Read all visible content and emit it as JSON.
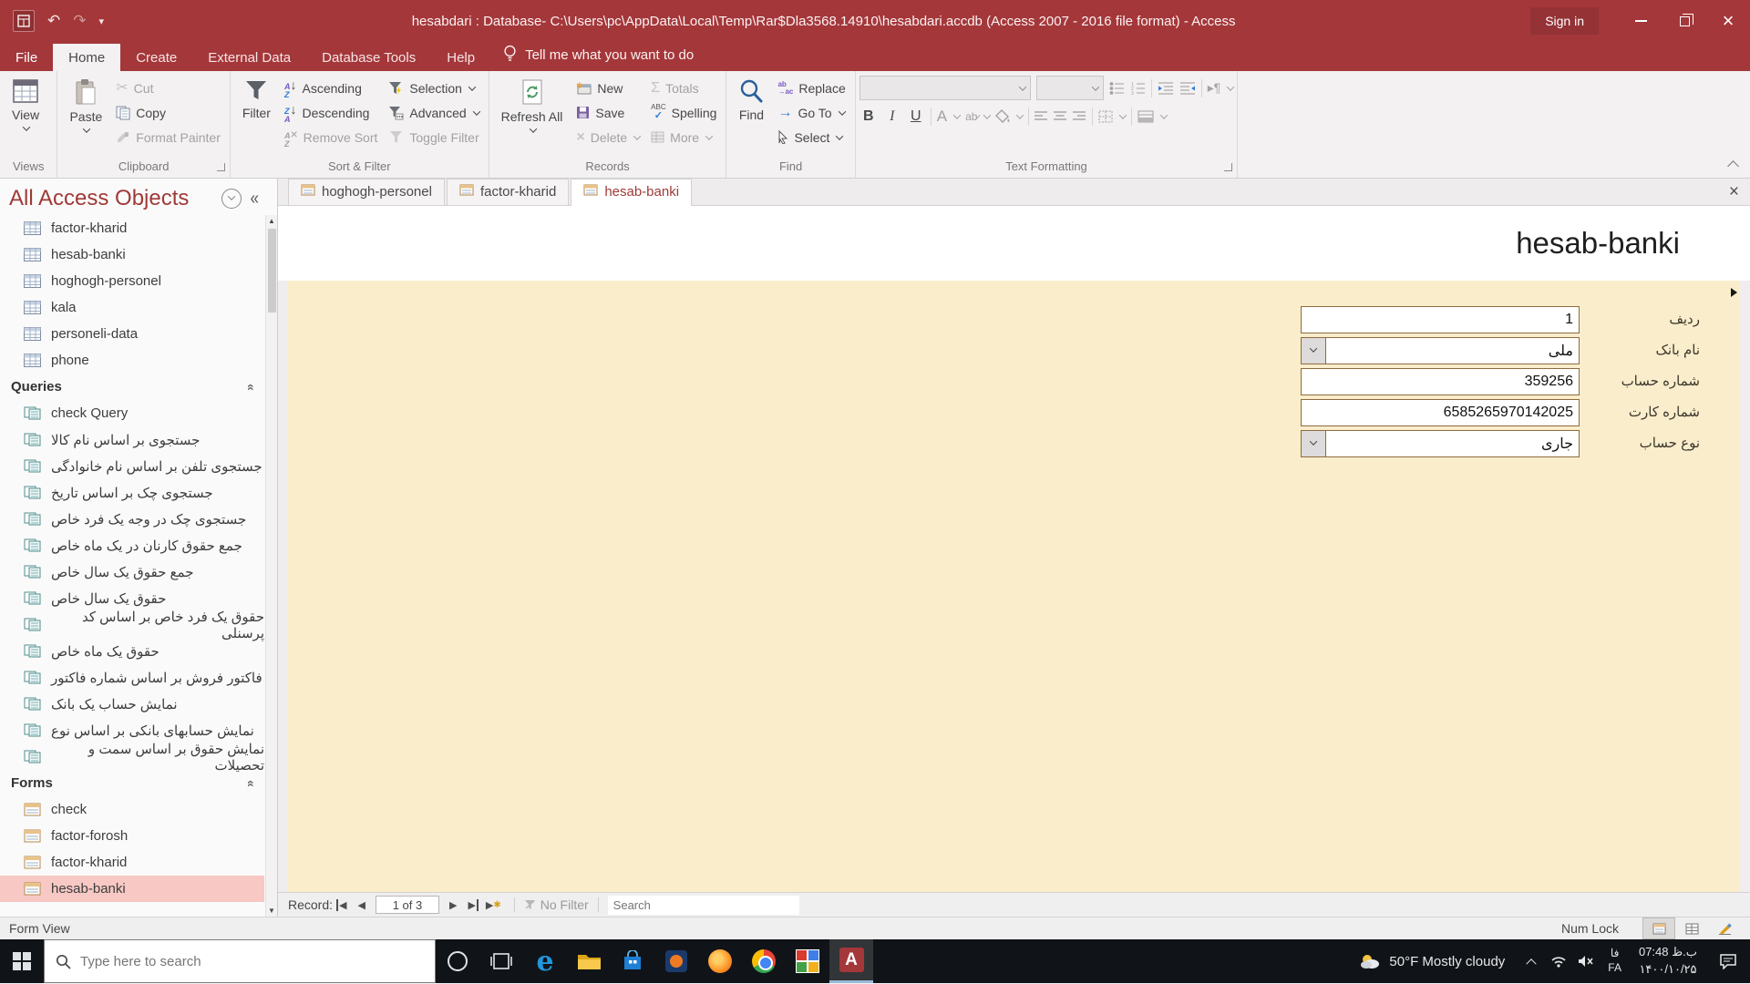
{
  "titlebar": {
    "title": "hesabdari : Database- C:\\Users\\pc\\AppData\\Local\\Temp\\Rar$Dla3568.14910\\hesabdari.accdb (Access 2007 - 2016 file format)  -  Access",
    "sign_in": "Sign in"
  },
  "menu": {
    "file": "File",
    "home": "Home",
    "create": "Create",
    "external_data": "External Data",
    "database_tools": "Database Tools",
    "help": "Help",
    "tell_me": "Tell me what you want to do"
  },
  "ribbon": {
    "views": {
      "label": "Views",
      "view": "View"
    },
    "clipboard": {
      "label": "Clipboard",
      "paste": "Paste",
      "cut": "Cut",
      "copy": "Copy",
      "format_painter": "Format Painter"
    },
    "sort_filter": {
      "label": "Sort & Filter",
      "filter": "Filter",
      "ascending": "Ascending",
      "descending": "Descending",
      "remove_sort": "Remove Sort",
      "selection": "Selection",
      "advanced": "Advanced",
      "toggle_filter": "Toggle Filter"
    },
    "records": {
      "label": "Records",
      "refresh_all": "Refresh All",
      "new": "New",
      "save": "Save",
      "delete": "Delete",
      "totals": "Totals",
      "spelling": "Spelling",
      "more": "More"
    },
    "find": {
      "label": "Find",
      "find": "Find",
      "replace": "Replace",
      "go_to": "Go To",
      "select": "Select"
    },
    "text_formatting": {
      "label": "Text Formatting"
    }
  },
  "nav": {
    "header": "All Access Objects",
    "tables": [
      "factor-kharid",
      "hesab-banki",
      "hoghogh-personel",
      "kala",
      "personeli-data",
      "phone"
    ],
    "queries_header": "Queries",
    "queries": [
      "check Query",
      "جستجوی بر اساس نام کالا",
      "جستجوی تلفن بر اساس نام خانوادگی",
      "جستجوی چک بر اساس تاریخ",
      "جستجوی چک در وجه یک فرد خاص",
      "جمع حقوق کارنان در یک ماه خاص",
      "جمع حقوق یک سال خاص",
      "حقوق یک سال خاص",
      "حقوق یک فرد خاص بر اساس کد پرسنلی",
      "حقوق یک ماه خاص",
      "فاکتور فروش بر اساس شماره فاکتور",
      "نمایش حساب یک بانک",
      "نمایش حسابهای بانکی بر اساس نوع",
      "نمایش حقوق بر اساس سمت و تحصیلات"
    ],
    "forms_header": "Forms",
    "forms": [
      "check",
      "factor-forosh",
      "factor-kharid",
      "hesab-banki"
    ],
    "selected_form": "hesab-banki"
  },
  "doc_tabs": [
    "hoghogh-personel",
    "factor-kharid",
    "hesab-banki"
  ],
  "form": {
    "title": "hesab-banki",
    "fields": [
      {
        "label": "ردیف",
        "value": "1"
      },
      {
        "label": "نام بانک",
        "value": "ملی"
      },
      {
        "label": "شماره حساب",
        "value": "359256"
      },
      {
        "label": "شماره کارت",
        "value": "6585265970142025"
      },
      {
        "label": "نوع حساب",
        "value": "جاری"
      }
    ]
  },
  "record_nav": {
    "record_label": "Record:",
    "position": "1 of 3",
    "no_filter": "No Filter",
    "search_placeholder": "Search"
  },
  "statusbar": {
    "left": "Form View",
    "num_lock": "Num Lock"
  },
  "taskbar": {
    "search_placeholder": "Type here to search",
    "weather": "50°F  Mostly cloudy",
    "lang_top": "فا",
    "lang_bottom": "FA",
    "time": "07:48 ب.ظ",
    "date": "۱۴۰۰/۱۰/۲۵"
  },
  "colors": {
    "accent": "#a4373a",
    "form_bg": "#faedcb",
    "field_border": "#8e6b3f",
    "nav_selection": "#f7c8c4"
  }
}
